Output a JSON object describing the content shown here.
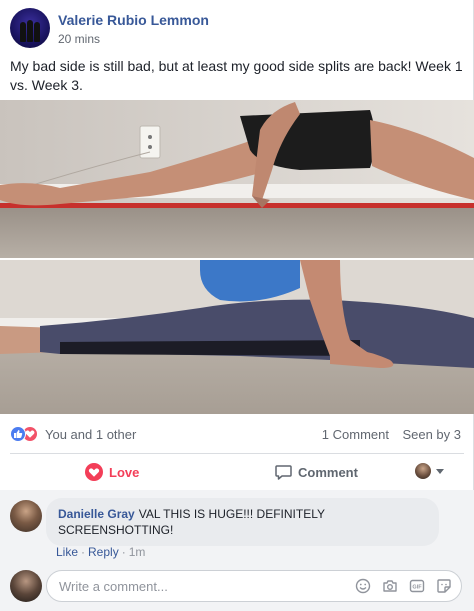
{
  "post": {
    "author": "Valerie Rubio Lemmon",
    "time": "20 mins",
    "text": "My bad side is still bad, but at least my good side splits are back! Week 1 vs. Week 3."
  },
  "reactions": {
    "summary": "You and 1 other",
    "comments": "1 Comment",
    "seen": "Seen by 3"
  },
  "actions": {
    "love_label": "Love",
    "comment_label": "Comment"
  },
  "comments": [
    {
      "author": "Danielle Gray",
      "text": "VAL THIS IS HUGE!!! DEFINITELY SCREENSHOTTING!",
      "like": "Like",
      "reply": "Reply",
      "age": "1m"
    }
  ],
  "composer": {
    "placeholder": "Write a comment..."
  },
  "icons": [
    "like-reaction-icon",
    "love-reaction-icon",
    "heart-icon",
    "speech-bubble-icon",
    "chevron-down-icon",
    "emoji-icon",
    "camera-icon",
    "gif-icon",
    "sticker-icon"
  ],
  "colors": {
    "link": "#385898",
    "love": "#f33e58",
    "like": "#4b7cf0",
    "muted": "#616770"
  }
}
